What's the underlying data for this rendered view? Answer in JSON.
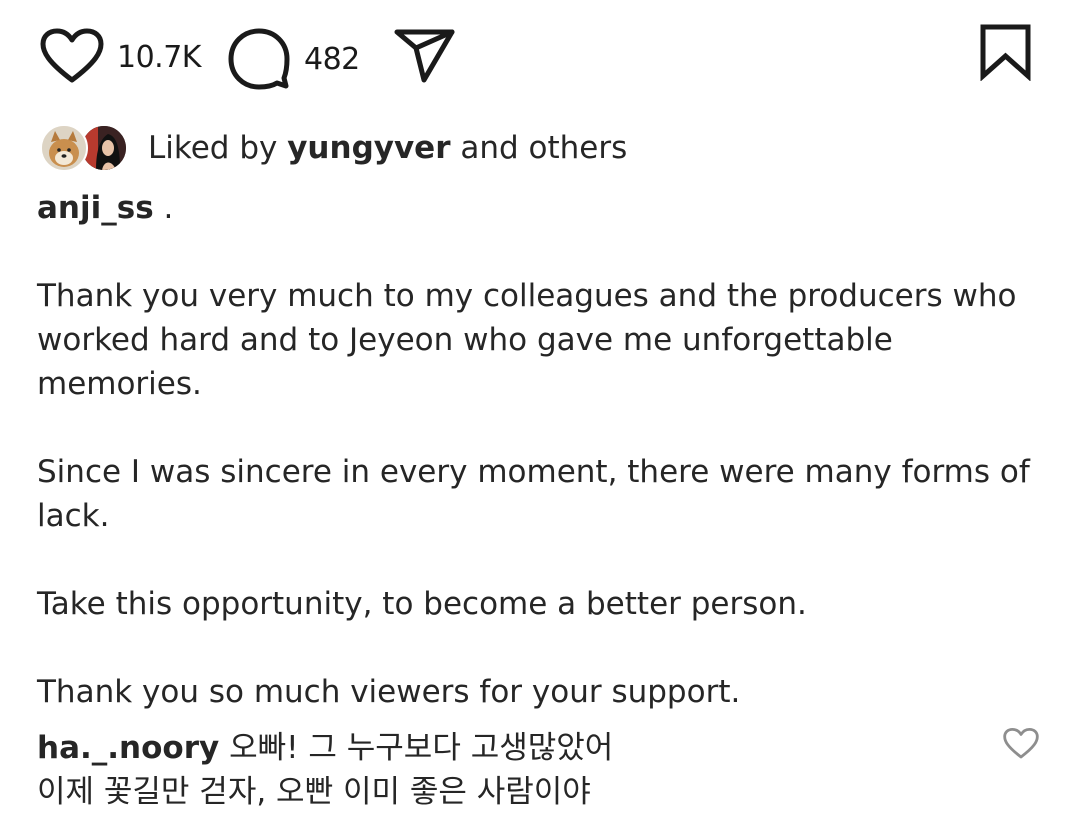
{
  "actions": {
    "like": {
      "icon": "heart-icon",
      "count": "10.7K"
    },
    "comment": {
      "icon": "comment-bubble-icon",
      "count": "482"
    },
    "share": {
      "icon": "paper-plane-icon"
    },
    "save": {
      "icon": "bookmark-icon"
    }
  },
  "likes": {
    "prefix": "Liked by",
    "user": "yungyver",
    "suffix": "and others"
  },
  "caption": {
    "username": "anji_ss",
    "title_suffix": ".",
    "paragraphs": [
      "Thank you very much to my colleagues and the producers who worked hard and to Jeyeon who gave me unforgettable memories.",
      "Since I was sincere in every moment, there were many forms of lack.",
      "Take this opportunity, to become a better person.",
      "Thank you so much viewers for your support."
    ]
  },
  "comment": {
    "username": "ha._.noory",
    "line1": "오빠! 그 누구보다 고생많았어",
    "line2": "이제 꽃길만 걷자, 오빤 이미 좋은 사람이야"
  }
}
